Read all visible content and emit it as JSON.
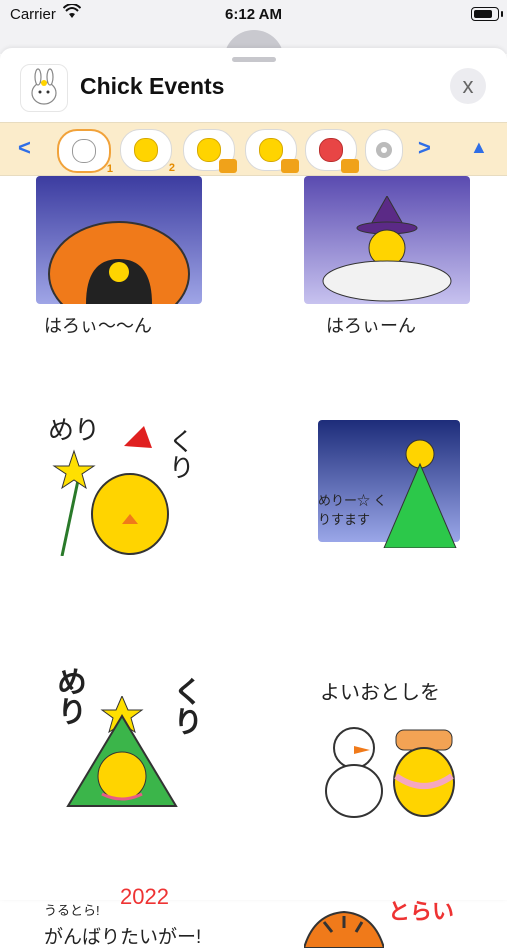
{
  "status": {
    "carrier": "Carrier",
    "time": "6:12 AM"
  },
  "header": {
    "title": "Chick Events",
    "close_icon": "x"
  },
  "tabs": {
    "prev_icon": "<",
    "next_icon": ">",
    "up_icon": "▲",
    "items": [
      {
        "badge": "1"
      },
      {
        "badge": "2"
      },
      {
        "badge": ""
      },
      {
        "badge": ""
      },
      {
        "badge": ""
      },
      {
        "badge": ""
      }
    ]
  },
  "stickers": {
    "s1": "はろぃ〜〜ん",
    "s2": "はろぃーん",
    "s3a": "めり",
    "s3b": "くり",
    "s4": "めりー☆ くりすます",
    "s5a": "めり",
    "s5b": "くり",
    "s6": "よいおとしを",
    "s7a": "うるとら!",
    "s7b": "2022",
    "s7c": "がんばりたいがー!",
    "s8": "とらい"
  }
}
